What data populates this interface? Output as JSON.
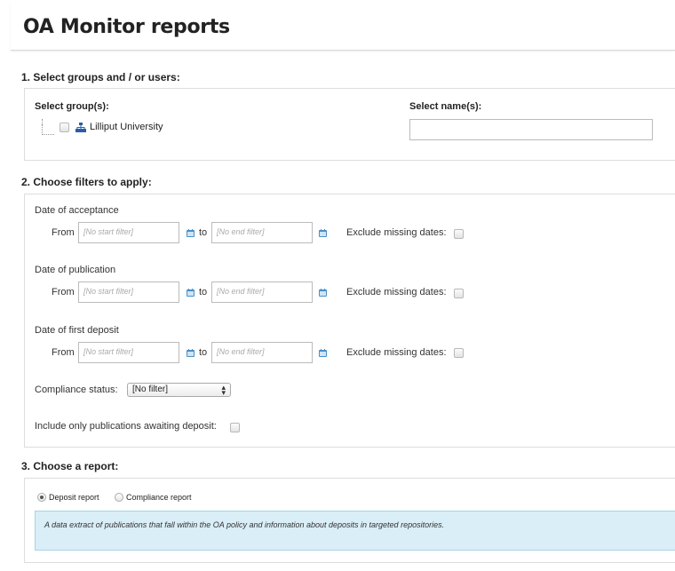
{
  "page": {
    "title": "OA Monitor reports"
  },
  "section1": {
    "heading": "1. Select groups and / or users:",
    "groups_label": "Select group(s):",
    "group_item": "Lilliput University",
    "names_label": "Select name(s):",
    "names_value": ""
  },
  "section2": {
    "heading": "2. Choose filters to apply:",
    "from_label": "From",
    "to_label": "to",
    "start_placeholder": "[No start filter]",
    "end_placeholder": "[No end filter]",
    "exclude_label": "Exclude missing dates:",
    "filters": [
      {
        "label": "Date of acceptance"
      },
      {
        "label": "Date of publication"
      },
      {
        "label": "Date of first deposit"
      }
    ],
    "compliance_label": "Compliance status:",
    "compliance_value": "[No filter]",
    "awaiting_label": "Include only publications awaiting deposit:"
  },
  "section3": {
    "heading": "3. Choose a report:",
    "options": [
      {
        "label": "Deposit report",
        "selected": true
      },
      {
        "label": "Compliance report",
        "selected": false
      }
    ],
    "description": "A data extract of publications that fall within the OA policy and information about deposits in targeted repositories."
  },
  "colors": {
    "info_bg": "#d9eef7",
    "calendar_icon": "#4a90c9",
    "tree_icon": "#2a5ea8"
  }
}
